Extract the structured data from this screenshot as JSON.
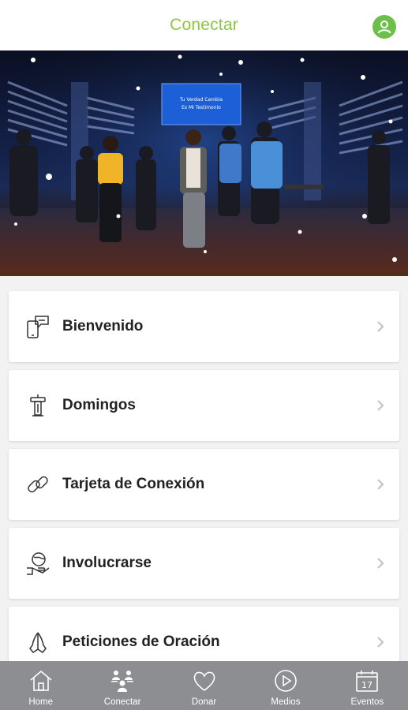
{
  "header": {
    "title": "Conectar",
    "profile_icon": "user-avatar-icon",
    "accent_color": "#8cc63f"
  },
  "hero": {
    "description_icon": "worship-stage-photo",
    "screen_text_line1": "Tu Verdad Cambia",
    "screen_text_line2": "Es Mi Testimonio"
  },
  "menu": {
    "items": [
      {
        "label": "Bienvenido",
        "icon": "phone-chat-icon"
      },
      {
        "label": "Domingos",
        "icon": "pulpit-icon"
      },
      {
        "label": "Tarjeta de Conexión",
        "icon": "link-icon"
      },
      {
        "label": "Involucrarse",
        "icon": "hand-globe-icon"
      },
      {
        "label": "Peticiones de Oración",
        "icon": "praying-hands-icon"
      }
    ],
    "chevron_icon": "chevron-right-icon"
  },
  "tabbar": {
    "background": "#8d8e92",
    "tabs": [
      {
        "label": "Home",
        "icon": "home-icon"
      },
      {
        "label": "Conectar",
        "icon": "people-icon"
      },
      {
        "label": "Donar",
        "icon": "heart-icon"
      },
      {
        "label": "Medios",
        "icon": "play-circle-icon"
      },
      {
        "label": "Eventos",
        "icon": "calendar-icon",
        "calendar_day": "17"
      }
    ]
  }
}
